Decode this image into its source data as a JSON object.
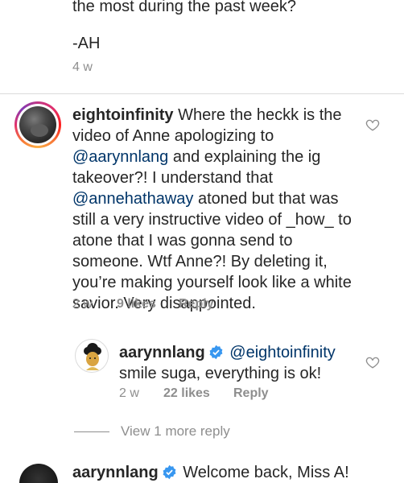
{
  "previous_comment": {
    "text_line": "the most during the past week?",
    "signature": "-AH",
    "time": "4 w"
  },
  "main_comment": {
    "username": "eightoinfinity",
    "text_before": "Where the heckk is the video of Anne apologizing to ",
    "mention1": "@aarynnlang",
    "text_middle": " and explaining the ig takeover?! I understand that ",
    "mention2": "@annehathaway",
    "text_after": " atoned but that was still a very instructive video of _how_ to atone that I was gonna send to someone. Wtf Anne?! By deleting it, you’re making yourself look like a white savior. Very disappointed.",
    "time": "2 w",
    "likes": "9 likes",
    "reply": "Reply"
  },
  "reply_comment": {
    "username": "aarynnlang",
    "mention": "@eightoinfinity",
    "text": "smile suga, everything is ok!",
    "time": "2 w",
    "likes": "22 likes",
    "reply": "Reply"
  },
  "view_more": "View 1 more reply",
  "bottom_comment": {
    "username": "aarynnlang",
    "text": "Welcome back, Miss A!"
  },
  "colors": {
    "mention": "#003569",
    "meta": "#8e8e8e",
    "verified": "#3897f0"
  }
}
